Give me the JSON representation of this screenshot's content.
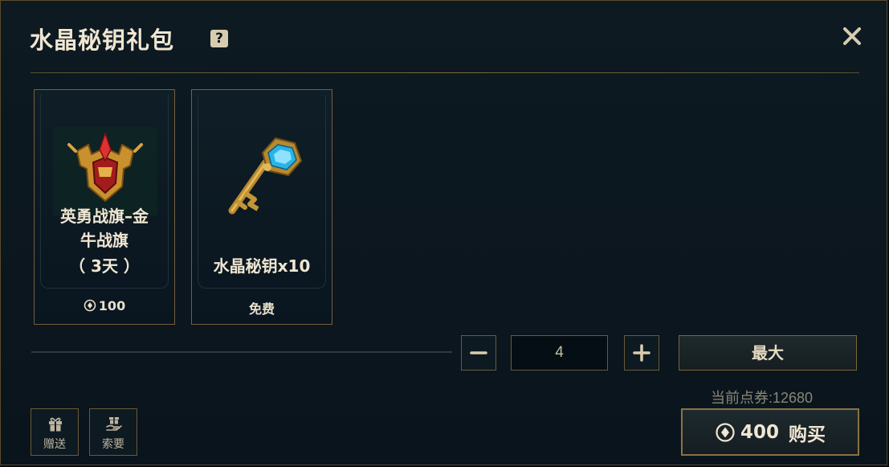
{
  "dialog": {
    "title": "水晶秘钥礼包",
    "help_icon": "question-icon",
    "close_icon": "close-icon"
  },
  "items": [
    {
      "name_lines": [
        "英勇战旗–金",
        "牛战旗",
        "（ 3天 ）"
      ],
      "price": "100",
      "price_icon": "rp-coin-icon",
      "image_icon": "golden-bull-banner-emblem"
    },
    {
      "name_lines": [
        "水晶秘钥x10"
      ],
      "price": "免费",
      "image_icon": "hextech-key"
    }
  ],
  "quantity": {
    "value": "4",
    "minus_icon": "minus-icon",
    "plus_icon": "plus-icon",
    "max_label": "最大"
  },
  "balance_text": "当前点券:12680",
  "buy": {
    "amount": "400",
    "label": "购买",
    "icon": "rp-coin-icon"
  },
  "actions": {
    "gift_label": "赠送",
    "gift_icon": "gift-icon",
    "request_label": "索要",
    "request_icon": "request-gift-icon"
  },
  "colors": {
    "background": "#0a141c",
    "gold_border": "#76603a",
    "text_primary": "#f0e6d2",
    "text_muted": "#8a8675"
  }
}
